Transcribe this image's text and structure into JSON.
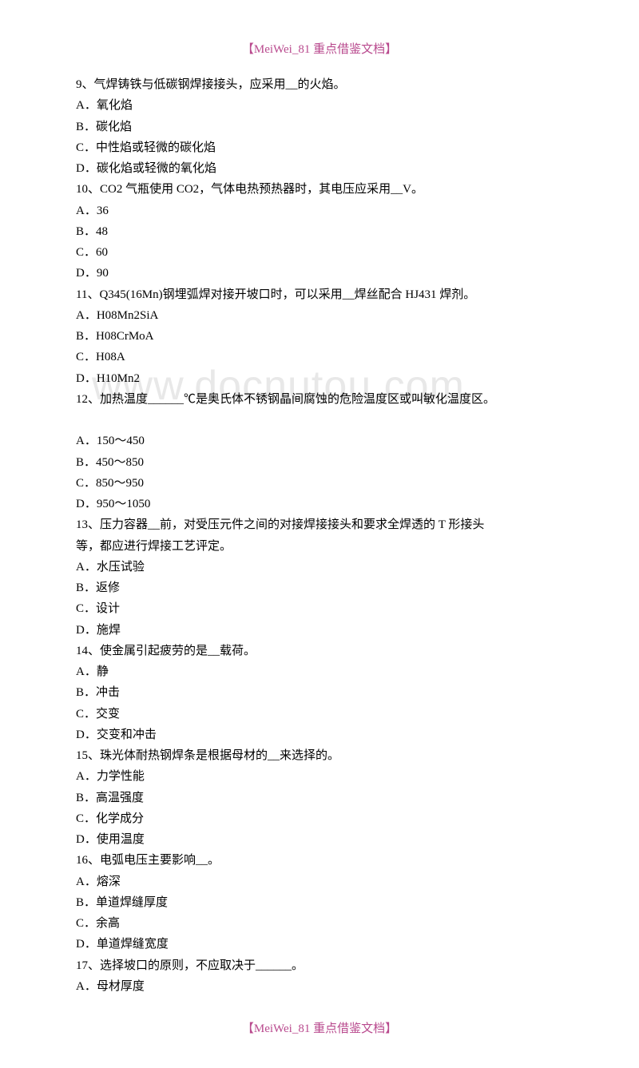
{
  "header": "【MeiWei_81 重点借鉴文档】",
  "footer": "【MeiWei_81 重点借鉴文档】",
  "watermark": "www.docnutou.com",
  "questions": [
    {
      "q": "9、气焊铸铁与低碳钢焊接接头，应采用__的火焰。",
      "opts": [
        "A．氧化焰",
        "B．碳化焰",
        "C．中性焰或轻微的碳化焰",
        "D．碳化焰或轻微的氧化焰"
      ]
    },
    {
      "q": "10、CO2 气瓶使用 CO2，气体电热预热器时，其电压应采用__V。",
      "opts": [
        "A．36",
        "B．48",
        "C．60",
        "D．90"
      ]
    },
    {
      "q": "11、Q345(16Mn)钢埋弧焊对接开坡口时，可以采用__焊丝配合 HJ431 焊剂。",
      "opts": [
        "A．H08Mn2SiA",
        "B．H08CrMoA",
        "C．H08A",
        "D．H10Mn2"
      ]
    },
    {
      "q": "12、加热温度______℃是奥氏体不锈钢晶间腐蚀的危险温度区或叫敏化温度区。",
      "blank": true,
      "opts": [
        "A．150～450",
        "B．450～850",
        "C．850～950",
        "D．950～1050"
      ]
    },
    {
      "q": "13、压力容器__前，对受压元件之间的对接焊接接头和要求全焊透的 T 形接头",
      "q2": "等，都应进行焊接工艺评定。",
      "opts": [
        "A．水压试验",
        "B．返修",
        "C．设计",
        "D．施焊"
      ]
    },
    {
      "q": "14、使金属引起疲劳的是__载荷。",
      "opts": [
        "A．静",
        "B．冲击",
        "C．交变",
        "D．交变和冲击"
      ]
    },
    {
      "q": "15、珠光体耐热钢焊条是根据母材的__来选择的。",
      "opts": [
        "A．力学性能",
        "B．高温强度",
        "C．化学成分",
        "D．使用温度"
      ]
    },
    {
      "q": "16、电弧电压主要影响__。",
      "opts": [
        "A．熔深",
        "B．单道焊缝厚度",
        "C．余高",
        "D．单道焊缝宽度"
      ]
    },
    {
      "q": "17、选择坡口的原则，不应取决于______。",
      "opts": [
        "A．母材厚度"
      ]
    }
  ]
}
